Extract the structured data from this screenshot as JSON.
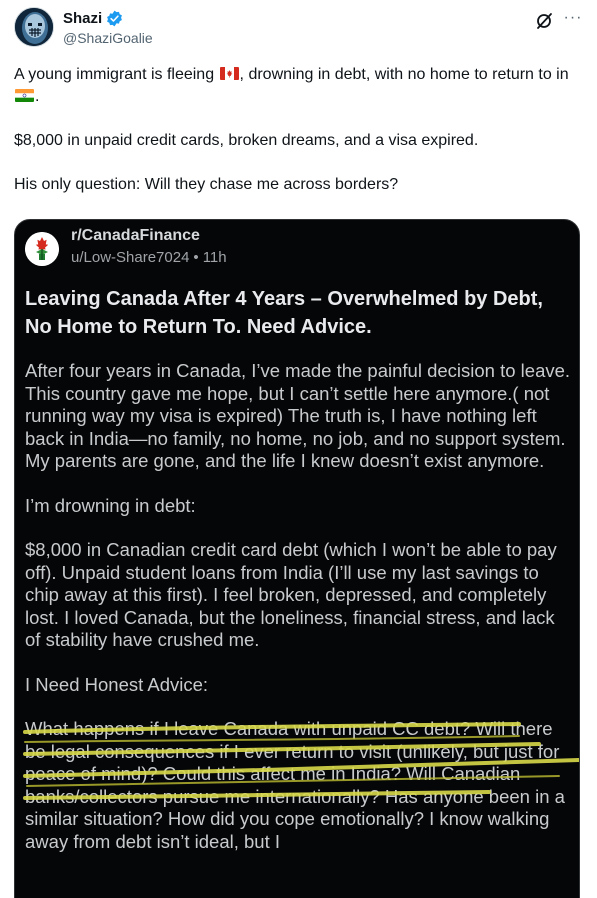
{
  "author": {
    "display_name": "Shazi",
    "handle": "@ShaziGoalie",
    "verified": true,
    "verified_color": "#1d9bf0"
  },
  "actions": {
    "grok_icon": "grok-icon",
    "more_icon": "more-icon",
    "more_label": "···"
  },
  "tweet": {
    "line1_pre": "A young immigrant is fleeing ",
    "line1_post": ", drowning in debt, with no home to return to in ",
    "line1_end": ".",
    "line2": "$8,000 in unpaid credit cards, broken dreams, and a visa expired.",
    "line3": "His only question: Will they chase me across borders?"
  },
  "embedded_post": {
    "subreddit": "r/CanadaFinance",
    "user": "u/Low-Share7024",
    "age": "11h",
    "separator": "•",
    "title": "Leaving Canada After 4 Years – Overwhelmed by Debt, No Home to Return To. Need Advice.",
    "para1": "After four years in Canada, I’ve made the painful decision to leave. This country gave me hope, but I can’t settle here anymore.( not running way my visa is expired) The truth is, I have nothing left back in India—no family, no home, no job, and no support system. My parents are gone, and the life I knew doesn’t exist anymore.",
    "para2": "I’m drowning in debt:",
    "para3": "$8,000 in Canadian credit card debt (which I won’t be able to pay off). Unpaid student loans from India (I’ll use my last savings to chip away at this first). I feel broken, depressed, and completely lost. I loved Canada, but the loneliness, financial stress, and lack of stability have crushed me.",
    "para4": "I Need Honest Advice:",
    "para5_highlighted": "What happens if I leave Canada with unpaid CC debt? Will there be legal consequences if I ever return to visit (unlikely, but just for peace of mind)? Could this affect me in India? Will Canadian banks/collectors pursue me internationally",
    "para5_rest": "? Has anyone been in a similar situation? How did you cope emotionally? I know walking away from debt isn’t ideal, but I",
    "highlight_color": "#d9d94a"
  },
  "colors": {
    "card_bg": "#050607",
    "text_primary": "#0f1419",
    "text_secondary": "#536471"
  }
}
